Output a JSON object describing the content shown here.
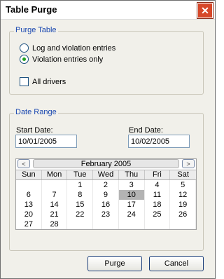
{
  "window": {
    "title": "Table Purge",
    "close_glyph": "✕"
  },
  "purge_table": {
    "group_label": "Purge Table",
    "options": [
      {
        "label": "Log and violation entries",
        "selected": false
      },
      {
        "label": "Violation entries only",
        "selected": true
      }
    ],
    "all_drivers": {
      "label": "All drivers",
      "checked": false
    }
  },
  "date_range": {
    "group_label": "Date Range",
    "start_label": "Start Date:",
    "start_value": "10/01/2005",
    "end_label": "End Date:",
    "end_value": "10/02/2005"
  },
  "calendar": {
    "prev": "<",
    "next": ">",
    "month_label": "February 2005",
    "weekdays": [
      "Sun",
      "Mon",
      "Tue",
      "Wed",
      "Thu",
      "Fri",
      "Sat"
    ],
    "weeks": [
      [
        "",
        "",
        "1",
        "2",
        "3",
        "4",
        "5"
      ],
      [
        "6",
        "7",
        "8",
        "9",
        "10",
        "11",
        "12"
      ],
      [
        "13",
        "14",
        "15",
        "16",
        "17",
        "18",
        "19"
      ],
      [
        "20",
        "21",
        "22",
        "23",
        "24",
        "25",
        "26"
      ],
      [
        "27",
        "28",
        "",
        "",
        "",
        "",
        ""
      ]
    ],
    "selected_day": "10"
  },
  "buttons": {
    "purge": "Purge",
    "cancel": "Cancel"
  }
}
